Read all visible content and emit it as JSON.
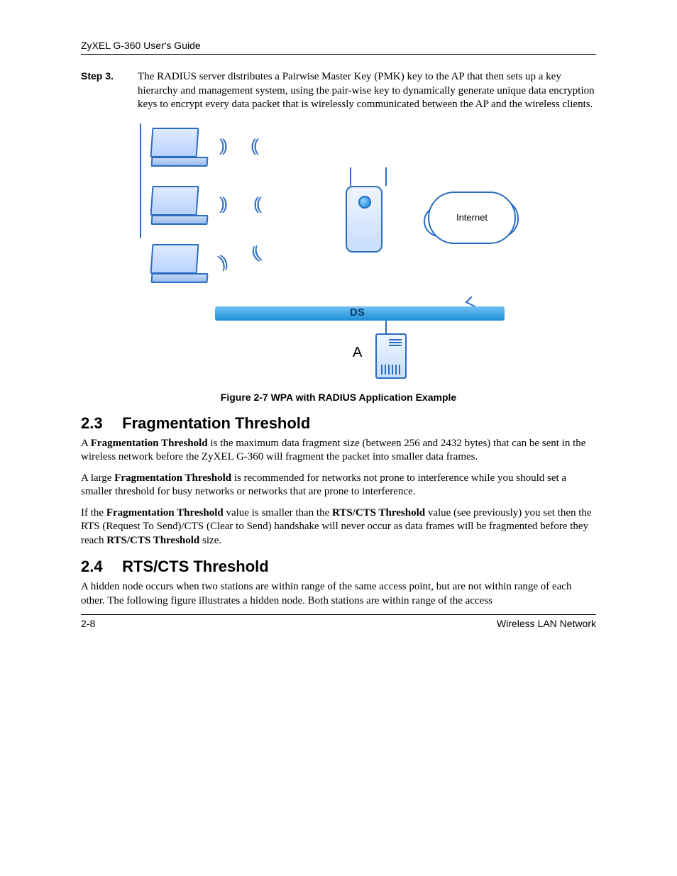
{
  "header": {
    "title": "ZyXEL G-360 User's Guide"
  },
  "step": {
    "label": "Step 3.",
    "text": "The RADIUS server distributes a Pairwise Master Key (PMK) key to the AP that then sets up a key hierarchy and management system, using the pair-wise key to dynamically generate unique data encryption keys to encrypt every data packet that is wirelessly communicated between the AP and the wireless clients."
  },
  "figure": {
    "caption": "Figure 2-7 WPA with RADIUS Application Example",
    "labels": {
      "internet": "Internet",
      "ds": "DS",
      "server": "A"
    }
  },
  "sections": {
    "s23": {
      "num": "2.3",
      "title": "Fragmentation Threshold",
      "p1a": "A ",
      "p1b": "Fragmentation Threshold",
      "p1c": " is the maximum data fragment size (between 256 and 2432 bytes) that can be sent in the wireless network before the ZyXEL G-360 will fragment the packet into smaller data frames.",
      "p2a": "A large ",
      "p2b": "Fragmentation Threshold",
      "p2c": " is recommended for networks not prone to interference while you should set a smaller threshold for busy networks or networks that are prone to interference.",
      "p3a": "If the ",
      "p3b": "Fragmentation Threshold",
      "p3c": " value is smaller than the ",
      "p3d": "RTS/CTS Threshold",
      "p3e": " value (see previously) you set then the RTS (Request To Send)/CTS (Clear to Send) handshake will never occur as data frames will be fragmented before they reach ",
      "p3f": "RTS/CTS Threshold",
      "p3g": " size."
    },
    "s24": {
      "num": "2.4",
      "title": "RTS/CTS Threshold",
      "p1": "A hidden node occurs when two stations are within range of the same access point, but are not within range of each other. The following figure illustrates a hidden node. Both stations are within range of the access"
    }
  },
  "footer": {
    "page": "2-8",
    "section": "Wireless LAN Network"
  }
}
